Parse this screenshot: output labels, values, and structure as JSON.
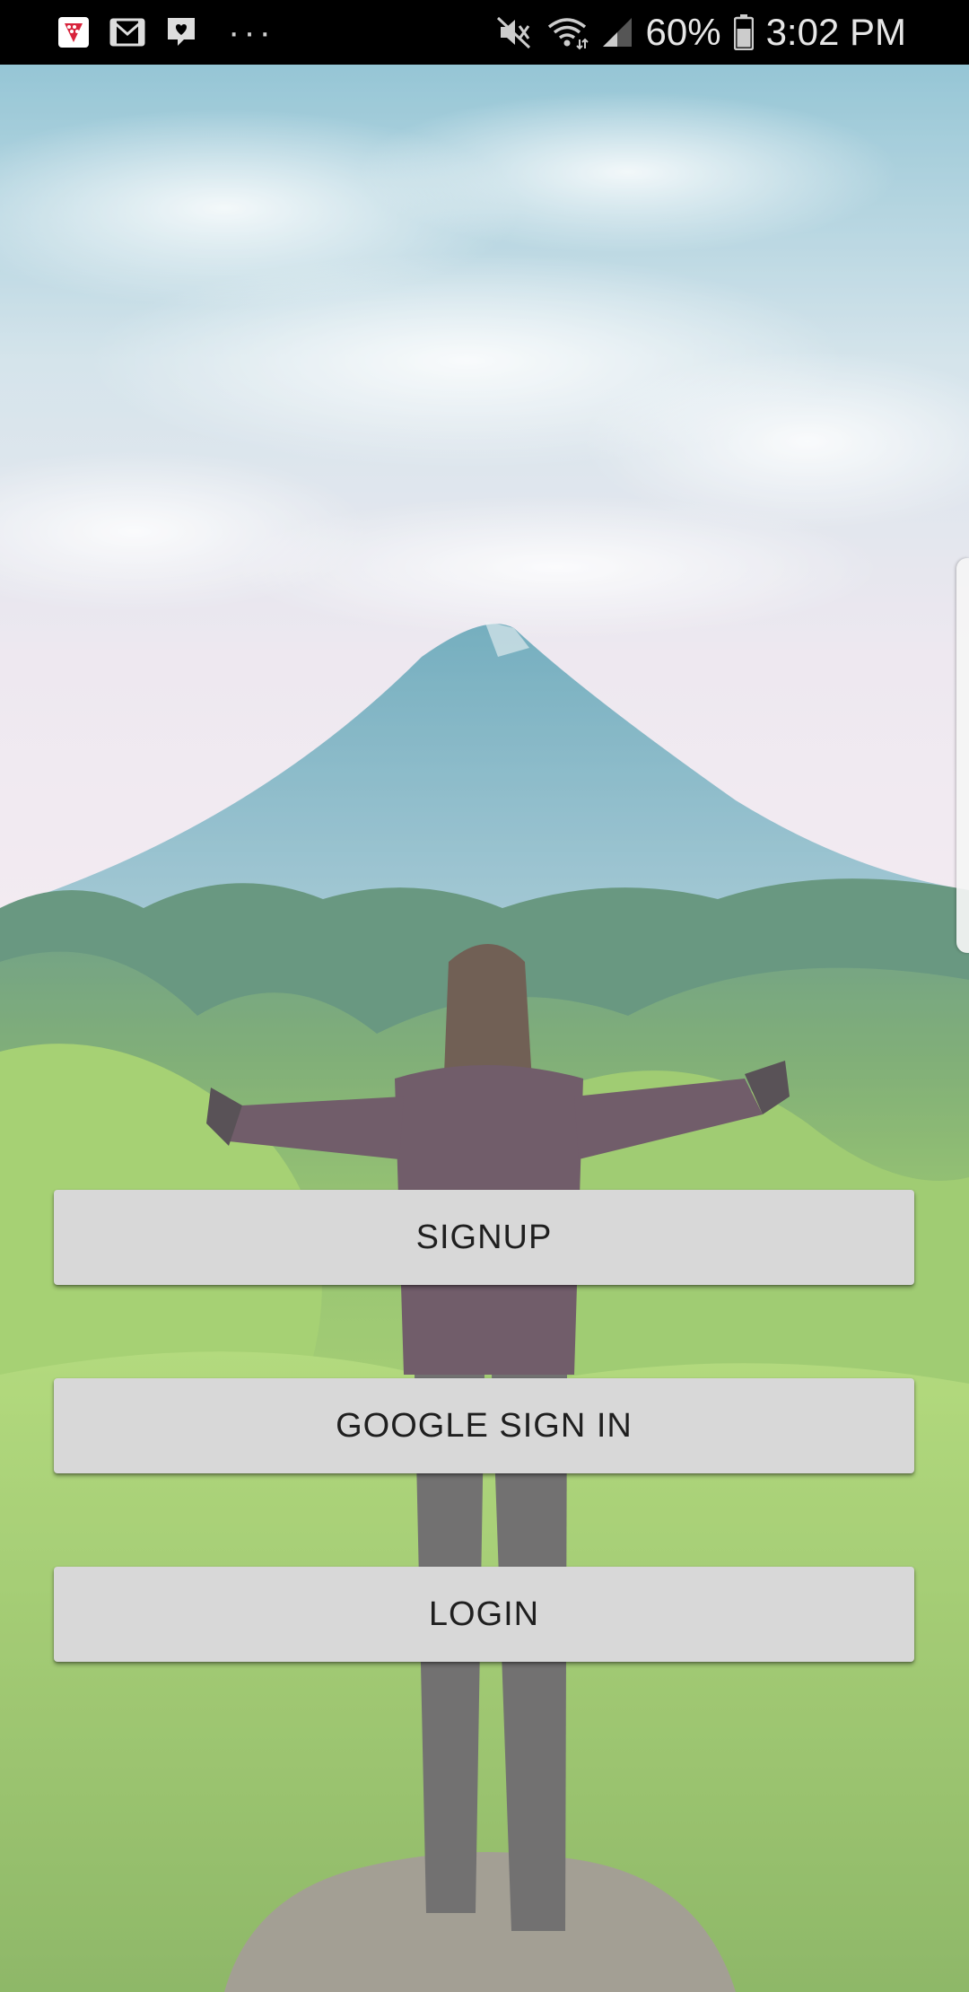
{
  "status_bar": {
    "battery_percent": "60%",
    "time": "3:02 PM",
    "overflow_indicator": "···",
    "left_icons": [
      "game-app-icon",
      "gmail-icon",
      "chat-heart-icon"
    ],
    "right_icons": [
      "mute-icon",
      "wifi-icon",
      "signal-icon",
      "battery-icon"
    ]
  },
  "buttons": {
    "signup": "SIGNUP",
    "google": "GOOGLE SIGN IN",
    "login": "LOGIN"
  },
  "colors": {
    "button_bg": "#d8d8d8",
    "button_text": "#1f1f1f",
    "status_bar_bg": "#000000"
  }
}
